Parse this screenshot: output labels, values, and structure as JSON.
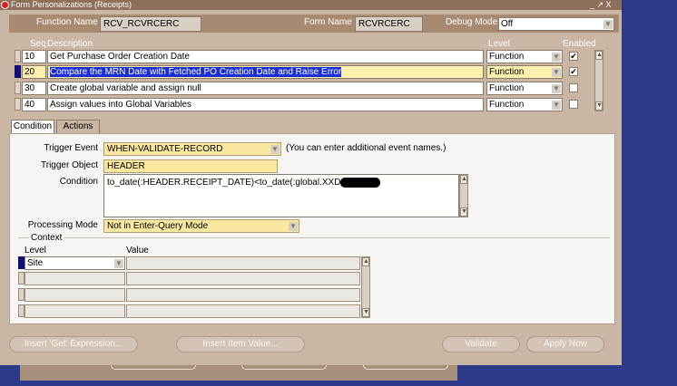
{
  "window": {
    "title": "Form Personalizations (Receipts)",
    "controls": "_ ↗ X"
  },
  "header": {
    "function_name_label": "Function Name",
    "function_name_value": "RCV_RCVRCERC",
    "form_name_label": "Form Name",
    "form_name_value": "RCVRCERC",
    "debug_mode_label": "Debug Mode",
    "debug_mode_value": "Off"
  },
  "grid": {
    "col_seq": "Seq",
    "col_description": "Description",
    "col_level": "Level",
    "col_enabled": "Enabled",
    "rows": [
      {
        "seq": "10",
        "description": "Get Purchase Order Creation Date",
        "level": "Function",
        "enabled": "✔"
      },
      {
        "seq": "20",
        "description": "Compare the MRN Date with Fetched PO Creation Date and Raise Error",
        "level": "Function",
        "enabled": "✔"
      },
      {
        "seq": "30",
        "description": "Create global variable and assign null",
        "level": "Function",
        "enabled": ""
      },
      {
        "seq": "40",
        "description": "Assign values into Global Variables",
        "level": "Function",
        "enabled": ""
      }
    ]
  },
  "tabs": {
    "condition": "Condition",
    "actions": "Actions"
  },
  "condition": {
    "trigger_event_label": "Trigger Event",
    "trigger_event_value": "WHEN-VALIDATE-RECORD",
    "trigger_event_hint": "(You can enter additional event names.)",
    "trigger_object_label": "Trigger Object",
    "trigger_object_value": "HEADER",
    "condition_label": "Condition",
    "condition_value": "to_date(:HEADER.RECEIPT_DATE)<to_date(:global.XXD",
    "processing_mode_label": "Processing Mode",
    "processing_mode_value": "Not in Enter-Query Mode"
  },
  "context": {
    "title": "Context",
    "level_header": "Level",
    "value_header": "Value",
    "rows": [
      {
        "level": "Site",
        "value": ""
      },
      {
        "level": "",
        "value": ""
      },
      {
        "level": "",
        "value": ""
      },
      {
        "level": "",
        "value": ""
      }
    ]
  },
  "buttons": {
    "insert_get": "Insert 'Get' Expression...",
    "insert_item": "Insert Item Value...",
    "validate": "Validate",
    "apply_now": "Apply Now"
  }
}
